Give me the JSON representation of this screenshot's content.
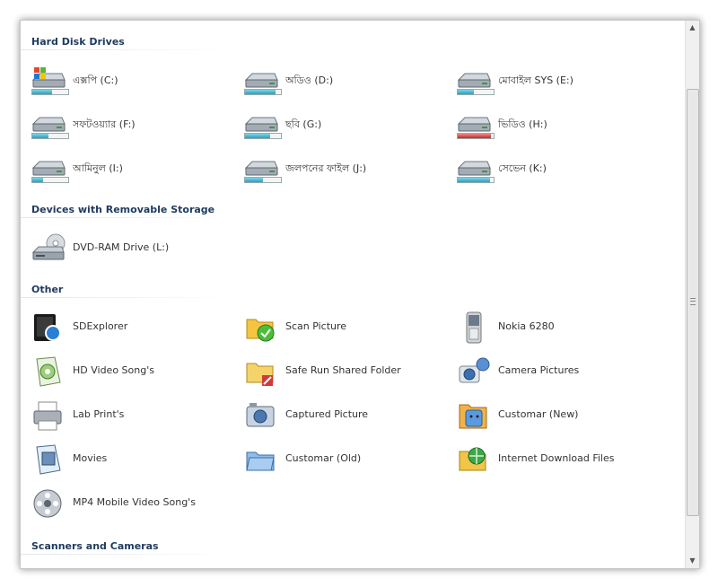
{
  "sections": {
    "hard_disk": {
      "title": "Hard Disk Drives",
      "items": [
        {
          "label": "এক্সপি (C:)",
          "fill": 0.55,
          "color": "#2aa0bd",
          "icon": "windows-drive-icon"
        },
        {
          "label": "অডিও (D:)",
          "fill": 0.85,
          "color": "#2aa0bd",
          "icon": "hard-drive-icon"
        },
        {
          "label": "মোবাইল SYS (E:)",
          "fill": 0.45,
          "color": "#2aa0bd",
          "icon": "hard-drive-icon"
        },
        {
          "label": "সফটওয়্যার (F:)",
          "fill": 0.45,
          "color": "#2aa0bd",
          "icon": "hard-drive-icon"
        },
        {
          "label": "ছবি (G:)",
          "fill": 0.7,
          "color": "#2aa0bd",
          "icon": "hard-drive-icon"
        },
        {
          "label": "ভিডিও (H:)",
          "fill": 0.92,
          "color": "#c02a2a",
          "icon": "hard-drive-icon"
        },
        {
          "label": "আমিনুল (I:)",
          "fill": 0.3,
          "color": "#2aa0bd",
          "icon": "hard-drive-icon"
        },
        {
          "label": "জলপনের ফাইল (J:)",
          "fill": 0.5,
          "color": "#2aa0bd",
          "icon": "hard-drive-icon"
        },
        {
          "label": "সেভেন (K:)",
          "fill": 0.9,
          "color": "#2aa0bd",
          "icon": "hard-drive-icon"
        }
      ]
    },
    "removable": {
      "title": "Devices with Removable Storage",
      "items": [
        {
          "label": "DVD-RAM Drive (L:)",
          "icon": "dvd-drive-icon"
        }
      ]
    },
    "other": {
      "title": "Other",
      "items": [
        {
          "label": "SDExplorer",
          "icon": "sd-explorer-icon"
        },
        {
          "label": "Scan Picture",
          "icon": "scan-folder-icon"
        },
        {
          "label": "Nokia 6280",
          "icon": "mobile-phone-icon"
        },
        {
          "label": "HD Video Song's",
          "icon": "video-file-icon"
        },
        {
          "label": "Safe Run Shared Folder",
          "icon": "shared-folder-icon"
        },
        {
          "label": "Camera Pictures",
          "icon": "camera-icon"
        },
        {
          "label": "Lab Print's",
          "icon": "printer-icon"
        },
        {
          "label": "Captured Picture",
          "icon": "photo-camera-icon"
        },
        {
          "label": "Customar (New)",
          "icon": "finder-face-icon"
        },
        {
          "label": "Movies",
          "icon": "film-file-icon"
        },
        {
          "label": "Customar (Old)",
          "icon": "blue-folder-icon"
        },
        {
          "label": "Internet Download Files",
          "icon": "internet-folder-icon"
        },
        {
          "label": "MP4 Mobile Video Song's",
          "icon": "film-reel-icon"
        }
      ]
    },
    "scanners": {
      "title": "Scanners and Cameras"
    }
  }
}
